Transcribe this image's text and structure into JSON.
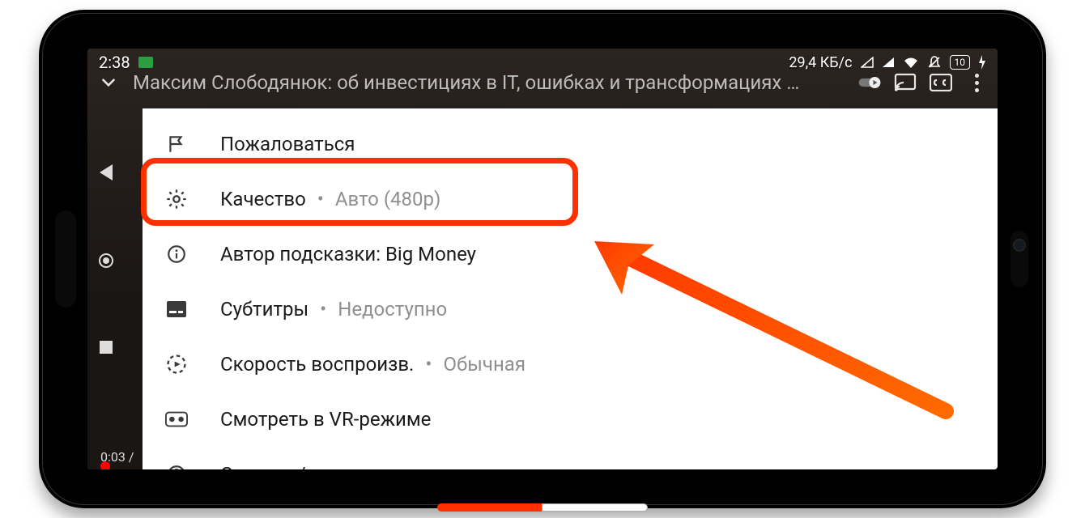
{
  "status": {
    "clock": "2:38",
    "net_speed": "29,4 КБ/с",
    "battery": "10"
  },
  "player": {
    "title": "Максим Слободянюк: об инвестициях в IT, ошибках и трансформациях …",
    "time": "0:03 /"
  },
  "menu": {
    "report": {
      "label": "Пожаловаться"
    },
    "quality": {
      "label": "Качество",
      "value": "Авто (480р)"
    },
    "cards": {
      "label": "Автор подсказки: Big Money"
    },
    "captions": {
      "label": "Субтитры",
      "value": "Недоступно"
    },
    "speed": {
      "label": "Скорость воспроизв.",
      "value": "Обычная"
    },
    "vr": {
      "label": "Смотреть в VR-режиме"
    },
    "help": {
      "label": "Справка/отзыв"
    }
  }
}
